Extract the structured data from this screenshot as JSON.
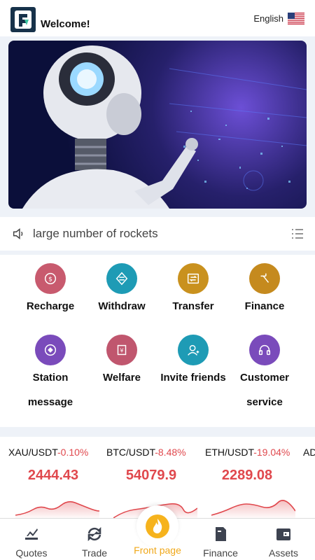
{
  "header": {
    "logo_icon": "app-logo",
    "welcome": "Welcome!",
    "language": "English",
    "flag_icon": "us-flag-icon"
  },
  "banner": {
    "image": "robot-touching-holographic-screen"
  },
  "notice": {
    "icon": "speaker-icon",
    "text": "large number of rockets",
    "list_icon": "list-icon"
  },
  "actions": [
    {
      "label": "Recharge",
      "icon": "recharge-icon",
      "color": "#c85a6e"
    },
    {
      "label": "Withdraw",
      "icon": "withdraw-icon",
      "color": "#1e9bb5"
    },
    {
      "label": "Transfer",
      "icon": "transfer-icon",
      "color": "#c9911e"
    },
    {
      "label": "Finance",
      "icon": "finance-icon",
      "color": "#c58a1e"
    },
    {
      "label": "Station message",
      "icon": "message-icon",
      "color": "#7a4bbb"
    },
    {
      "label": "Welfare",
      "icon": "welfare-icon",
      "color": "#c0566e"
    },
    {
      "label": "Invite friends",
      "icon": "invite-icon",
      "color": "#1e9bb5"
    },
    {
      "label": "Customer service",
      "icon": "headset-icon",
      "color": "#7a4bbb"
    }
  ],
  "market": {
    "accent": "#e0484d",
    "tickers": [
      {
        "pair": "XAU/USDT",
        "change": "-0.10%",
        "price": "2444.43"
      },
      {
        "pair": "BTC/USDT",
        "change": "-8.48%",
        "price": "54079.9"
      },
      {
        "pair": "ETH/USDT",
        "change": "-19.04%",
        "price": "2289.08"
      },
      {
        "pair": "AD",
        "change": "",
        "price": ""
      }
    ]
  },
  "tabs": [
    {
      "label": "Quotes",
      "icon": "quotes-icon"
    },
    {
      "label": "Trade",
      "icon": "trade-icon"
    },
    {
      "label": "Front page",
      "icon": "flame-icon",
      "active": true,
      "color": "#f0a81a"
    },
    {
      "label": "Finance",
      "icon": "finance-doc-icon"
    },
    {
      "label": "Assets",
      "icon": "wallet-icon"
    }
  ]
}
